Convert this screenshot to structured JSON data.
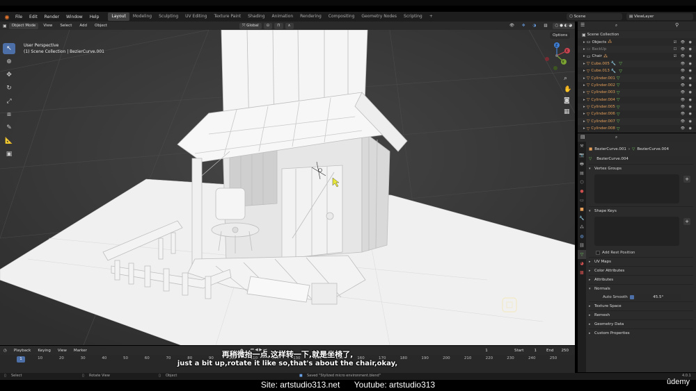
{
  "menubar": {
    "menus": [
      "File",
      "Edit",
      "Render",
      "Window",
      "Help"
    ],
    "workspaces": [
      "Layout",
      "Modeling",
      "Sculpting",
      "UV Editing",
      "Texture Paint",
      "Shading",
      "Animation",
      "Rendering",
      "Compositing",
      "Geometry Nodes",
      "Scripting"
    ],
    "active_workspace": "Layout",
    "add_tab": "+",
    "scene": "Scene",
    "view_layer": "ViewLayer"
  },
  "viewport_header": {
    "mode": "Object Mode",
    "menus": [
      "View",
      "Select",
      "Add",
      "Object"
    ],
    "transform_orientation": "Global",
    "options": "Options"
  },
  "viewport": {
    "perspective": "User Perspective",
    "collection_info": "(1) Scene Collection | BezierCurve.001",
    "gizmo_axes": [
      "X",
      "Y",
      "Z"
    ]
  },
  "outliner": {
    "rows": [
      {
        "name": "Scene Collection",
        "type": "collection"
      },
      {
        "name": "Objects",
        "type": "collection"
      },
      {
        "name": "BackUp",
        "type": "dim"
      },
      {
        "name": "Chair",
        "type": "collection"
      },
      {
        "name": "Cube.005",
        "type": "object"
      },
      {
        "name": "Cube.013",
        "type": "object"
      },
      {
        "name": "Cylinder.001",
        "type": "object"
      },
      {
        "name": "Cylinder.002",
        "type": "object"
      },
      {
        "name": "Cylinder.003",
        "type": "object"
      },
      {
        "name": "Cylinder.004",
        "type": "object"
      },
      {
        "name": "Cylinder.005",
        "type": "object"
      },
      {
        "name": "Cylinder.006",
        "type": "object"
      },
      {
        "name": "Cylinder.007",
        "type": "object"
      },
      {
        "name": "Cylinder.008",
        "type": "object"
      }
    ]
  },
  "properties": {
    "breadcrumb_object": "BezierCurve.001",
    "breadcrumb_data": "BezierCurve.004",
    "data_name": "BezierCurve.004",
    "panels": {
      "vertex_groups": "Vertex Groups",
      "shape_keys": "Shape Keys",
      "add_rest_position": "Add Rest Position",
      "uv_maps": "UV Maps",
      "color_attributes": "Color Attributes",
      "attributes": "Attributes",
      "normals": "Normals",
      "auto_smooth": "Auto Smooth",
      "auto_smooth_angle": "45.5°",
      "texture_space": "Texture Space",
      "remesh": "Remesh",
      "geometry_data": "Geometry Data",
      "custom_properties": "Custom Properties"
    }
  },
  "timeline": {
    "menus": [
      "Playback",
      "Keying",
      "View",
      "Marker"
    ],
    "current_frame": "1",
    "start_label": "Start",
    "start": "1",
    "end_label": "End",
    "end": "250",
    "ticks": [
      "1",
      "10",
      "20",
      "30",
      "40",
      "50",
      "60",
      "70",
      "80",
      "90",
      "100",
      "110",
      "120",
      "130",
      "140",
      "150",
      "160",
      "170",
      "180",
      "190",
      "200",
      "210",
      "220",
      "230",
      "240",
      "250"
    ]
  },
  "statusbar": {
    "select": "Select",
    "rotate_view": "Rotate View",
    "object": "Object",
    "saved_message": "Saved \"Stylized micro environment.blend\"",
    "version": "4.0.1"
  },
  "subtitles": {
    "chinese": "再稍微抬一点,这样转一下,就是坐椅了,",
    "english": "just a bit up,rotate it like so,that's about the chair,okay,"
  },
  "footer": {
    "site": "Site: artstudio313.net",
    "youtube": "Youtube: artstudio313",
    "brand": "ûdemy"
  },
  "colors": {
    "accent": "#4d6fa8",
    "object_name": "#e6a05a",
    "mesh_data": "#6ecb5a",
    "viewport_bg": "#3c3c3c",
    "model": "#f2f2f2"
  }
}
